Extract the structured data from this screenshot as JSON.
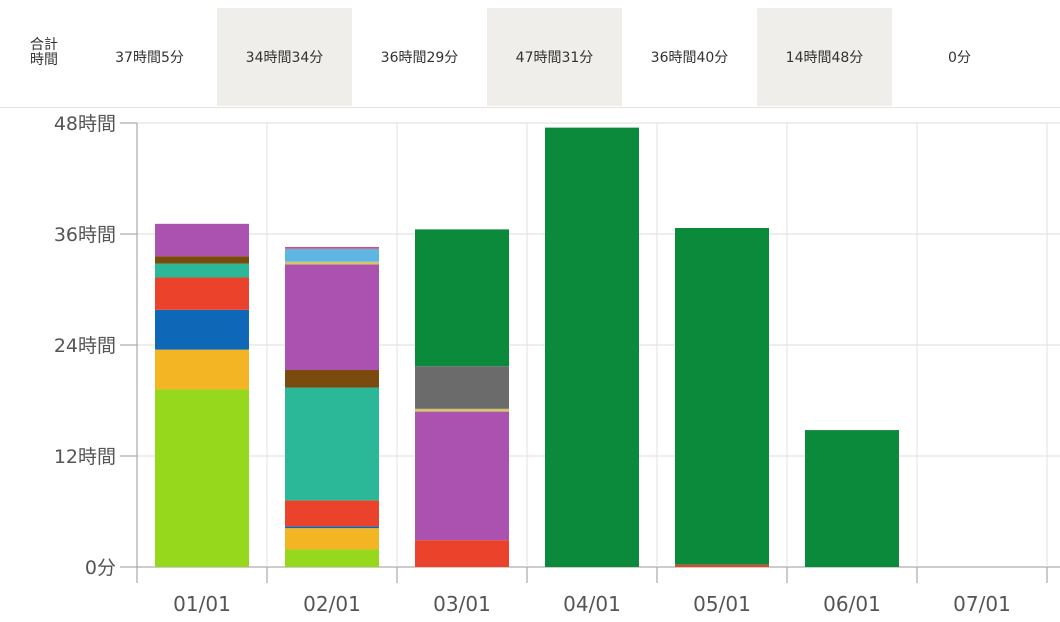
{
  "totals_header": {
    "label_line1": "合計",
    "label_line2": "時間",
    "totals": [
      "37時間5分",
      "34時間34分",
      "36時間29分",
      "47時間31分",
      "36時間40分",
      "14時間48分",
      "0分"
    ]
  },
  "chart_data": {
    "type": "bar",
    "stacked": true,
    "categories": [
      "01/01",
      "02/01",
      "03/01",
      "04/01",
      "05/01",
      "06/01",
      "07/01"
    ],
    "ylim": [
      0,
      48
    ],
    "yticks": [
      0,
      12,
      24,
      36,
      48
    ],
    "ytick_labels": [
      "0分",
      "12時間",
      "24時間",
      "36時間",
      "48時間"
    ],
    "grid": true,
    "series": [
      {
        "color": "#95d81c",
        "values": [
          19.2,
          1.9,
          0,
          0,
          0,
          0,
          0
        ]
      },
      {
        "color": "#f4b524",
        "values": [
          4.3,
          2.3,
          0,
          0,
          0,
          0,
          0
        ]
      },
      {
        "color": "#0f67b7",
        "values": [
          4.3,
          0.2,
          0,
          0,
          0,
          0,
          0
        ]
      },
      {
        "color": "#eb432b",
        "values": [
          3.5,
          2.8,
          2.9,
          0,
          0.25,
          0,
          0
        ]
      },
      {
        "color": "#2bb898",
        "values": [
          1.5,
          12.2,
          0,
          0,
          0,
          0,
          0
        ]
      },
      {
        "color": "#7b4a0e",
        "values": [
          0.8,
          1.9,
          0,
          0,
          0,
          0,
          0
        ]
      },
      {
        "color": "#ab52b1",
        "values": [
          3.5,
          11.4,
          13.9,
          0,
          0,
          0,
          0
        ]
      },
      {
        "color": "#d4c76a",
        "values": [
          0,
          0.3,
          0.3,
          0,
          0,
          0,
          0
        ]
      },
      {
        "color": "#5fb6e3",
        "values": [
          0,
          1.4,
          0,
          0,
          0,
          0,
          0
        ]
      },
      {
        "color": "#6b6b6b",
        "values": [
          0,
          0,
          4.6,
          0,
          0,
          0,
          0
        ]
      },
      {
        "color": "#d0507d",
        "values": [
          0,
          0.2,
          0,
          0,
          0,
          0,
          0
        ]
      },
      {
        "color": "#0a8a3a",
        "values": [
          0,
          0,
          14.8,
          47.5,
          36.4,
          14.8,
          0
        ]
      }
    ]
  }
}
